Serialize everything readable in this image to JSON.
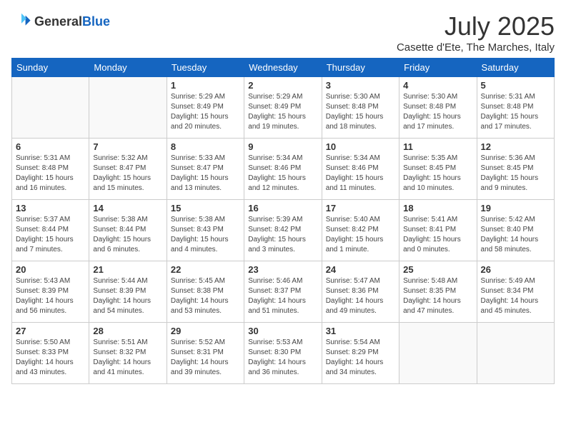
{
  "header": {
    "logo_general": "General",
    "logo_blue": "Blue",
    "month_year": "July 2025",
    "location": "Casette d'Ete, The Marches, Italy"
  },
  "weekdays": [
    "Sunday",
    "Monday",
    "Tuesday",
    "Wednesday",
    "Thursday",
    "Friday",
    "Saturday"
  ],
  "weeks": [
    [
      {
        "day": "",
        "empty": true
      },
      {
        "day": "",
        "empty": true
      },
      {
        "day": "1",
        "sunrise": "Sunrise: 5:29 AM",
        "sunset": "Sunset: 8:49 PM",
        "daylight": "Daylight: 15 hours and 20 minutes."
      },
      {
        "day": "2",
        "sunrise": "Sunrise: 5:29 AM",
        "sunset": "Sunset: 8:49 PM",
        "daylight": "Daylight: 15 hours and 19 minutes."
      },
      {
        "day": "3",
        "sunrise": "Sunrise: 5:30 AM",
        "sunset": "Sunset: 8:48 PM",
        "daylight": "Daylight: 15 hours and 18 minutes."
      },
      {
        "day": "4",
        "sunrise": "Sunrise: 5:30 AM",
        "sunset": "Sunset: 8:48 PM",
        "daylight": "Daylight: 15 hours and 17 minutes."
      },
      {
        "day": "5",
        "sunrise": "Sunrise: 5:31 AM",
        "sunset": "Sunset: 8:48 PM",
        "daylight": "Daylight: 15 hours and 17 minutes."
      }
    ],
    [
      {
        "day": "6",
        "sunrise": "Sunrise: 5:31 AM",
        "sunset": "Sunset: 8:48 PM",
        "daylight": "Daylight: 15 hours and 16 minutes."
      },
      {
        "day": "7",
        "sunrise": "Sunrise: 5:32 AM",
        "sunset": "Sunset: 8:47 PM",
        "daylight": "Daylight: 15 hours and 15 minutes."
      },
      {
        "day": "8",
        "sunrise": "Sunrise: 5:33 AM",
        "sunset": "Sunset: 8:47 PM",
        "daylight": "Daylight: 15 hours and 13 minutes."
      },
      {
        "day": "9",
        "sunrise": "Sunrise: 5:34 AM",
        "sunset": "Sunset: 8:46 PM",
        "daylight": "Daylight: 15 hours and 12 minutes."
      },
      {
        "day": "10",
        "sunrise": "Sunrise: 5:34 AM",
        "sunset": "Sunset: 8:46 PM",
        "daylight": "Daylight: 15 hours and 11 minutes."
      },
      {
        "day": "11",
        "sunrise": "Sunrise: 5:35 AM",
        "sunset": "Sunset: 8:45 PM",
        "daylight": "Daylight: 15 hours and 10 minutes."
      },
      {
        "day": "12",
        "sunrise": "Sunrise: 5:36 AM",
        "sunset": "Sunset: 8:45 PM",
        "daylight": "Daylight: 15 hours and 9 minutes."
      }
    ],
    [
      {
        "day": "13",
        "sunrise": "Sunrise: 5:37 AM",
        "sunset": "Sunset: 8:44 PM",
        "daylight": "Daylight: 15 hours and 7 minutes."
      },
      {
        "day": "14",
        "sunrise": "Sunrise: 5:38 AM",
        "sunset": "Sunset: 8:44 PM",
        "daylight": "Daylight: 15 hours and 6 minutes."
      },
      {
        "day": "15",
        "sunrise": "Sunrise: 5:38 AM",
        "sunset": "Sunset: 8:43 PM",
        "daylight": "Daylight: 15 hours and 4 minutes."
      },
      {
        "day": "16",
        "sunrise": "Sunrise: 5:39 AM",
        "sunset": "Sunset: 8:42 PM",
        "daylight": "Daylight: 15 hours and 3 minutes."
      },
      {
        "day": "17",
        "sunrise": "Sunrise: 5:40 AM",
        "sunset": "Sunset: 8:42 PM",
        "daylight": "Daylight: 15 hours and 1 minute."
      },
      {
        "day": "18",
        "sunrise": "Sunrise: 5:41 AM",
        "sunset": "Sunset: 8:41 PM",
        "daylight": "Daylight: 15 hours and 0 minutes."
      },
      {
        "day": "19",
        "sunrise": "Sunrise: 5:42 AM",
        "sunset": "Sunset: 8:40 PM",
        "daylight": "Daylight: 14 hours and 58 minutes."
      }
    ],
    [
      {
        "day": "20",
        "sunrise": "Sunrise: 5:43 AM",
        "sunset": "Sunset: 8:39 PM",
        "daylight": "Daylight: 14 hours and 56 minutes."
      },
      {
        "day": "21",
        "sunrise": "Sunrise: 5:44 AM",
        "sunset": "Sunset: 8:39 PM",
        "daylight": "Daylight: 14 hours and 54 minutes."
      },
      {
        "day": "22",
        "sunrise": "Sunrise: 5:45 AM",
        "sunset": "Sunset: 8:38 PM",
        "daylight": "Daylight: 14 hours and 53 minutes."
      },
      {
        "day": "23",
        "sunrise": "Sunrise: 5:46 AM",
        "sunset": "Sunset: 8:37 PM",
        "daylight": "Daylight: 14 hours and 51 minutes."
      },
      {
        "day": "24",
        "sunrise": "Sunrise: 5:47 AM",
        "sunset": "Sunset: 8:36 PM",
        "daylight": "Daylight: 14 hours and 49 minutes."
      },
      {
        "day": "25",
        "sunrise": "Sunrise: 5:48 AM",
        "sunset": "Sunset: 8:35 PM",
        "daylight": "Daylight: 14 hours and 47 minutes."
      },
      {
        "day": "26",
        "sunrise": "Sunrise: 5:49 AM",
        "sunset": "Sunset: 8:34 PM",
        "daylight": "Daylight: 14 hours and 45 minutes."
      }
    ],
    [
      {
        "day": "27",
        "sunrise": "Sunrise: 5:50 AM",
        "sunset": "Sunset: 8:33 PM",
        "daylight": "Daylight: 14 hours and 43 minutes."
      },
      {
        "day": "28",
        "sunrise": "Sunrise: 5:51 AM",
        "sunset": "Sunset: 8:32 PM",
        "daylight": "Daylight: 14 hours and 41 minutes."
      },
      {
        "day": "29",
        "sunrise": "Sunrise: 5:52 AM",
        "sunset": "Sunset: 8:31 PM",
        "daylight": "Daylight: 14 hours and 39 minutes."
      },
      {
        "day": "30",
        "sunrise": "Sunrise: 5:53 AM",
        "sunset": "Sunset: 8:30 PM",
        "daylight": "Daylight: 14 hours and 36 minutes."
      },
      {
        "day": "31",
        "sunrise": "Sunrise: 5:54 AM",
        "sunset": "Sunset: 8:29 PM",
        "daylight": "Daylight: 14 hours and 34 minutes."
      },
      {
        "day": "",
        "empty": true
      },
      {
        "day": "",
        "empty": true
      }
    ]
  ]
}
